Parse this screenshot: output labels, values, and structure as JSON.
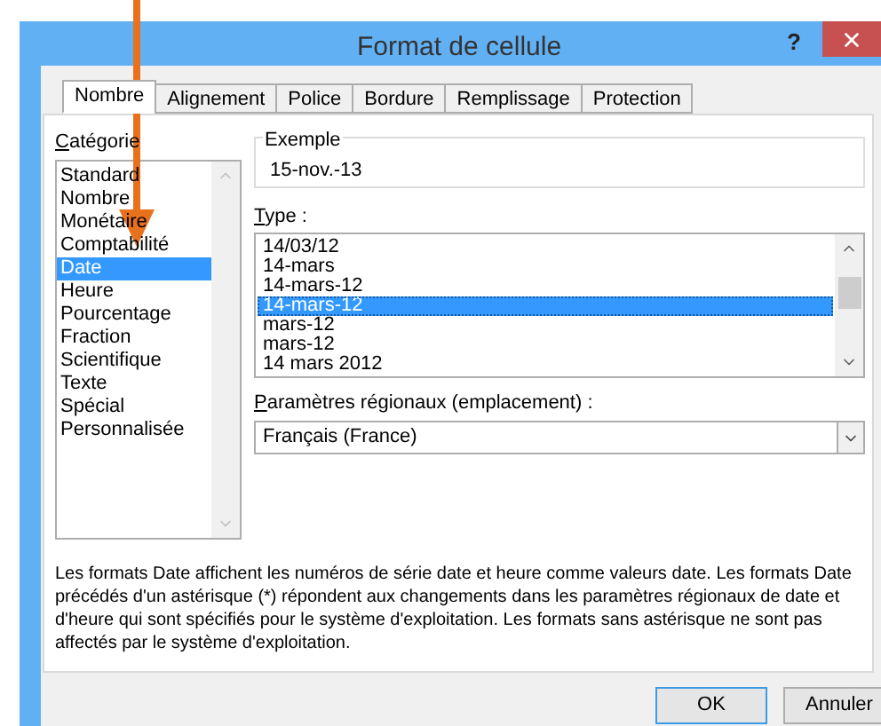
{
  "window": {
    "title": "Format de cellule",
    "help": "?"
  },
  "tabs": [
    {
      "label": "Nombre",
      "selected": true
    },
    {
      "label": "Alignement",
      "selected": false
    },
    {
      "label": "Police",
      "selected": false
    },
    {
      "label": "Bordure",
      "selected": false
    },
    {
      "label": "Remplissage",
      "selected": false
    },
    {
      "label": "Protection",
      "selected": false
    }
  ],
  "category": {
    "label": "Catégorie",
    "items": [
      {
        "label": "Standard",
        "selected": false
      },
      {
        "label": "Nombre",
        "selected": false
      },
      {
        "label": "Monétaire",
        "selected": false
      },
      {
        "label": "Comptabilité",
        "selected": false
      },
      {
        "label": "Date",
        "selected": true
      },
      {
        "label": "Heure",
        "selected": false
      },
      {
        "label": "Pourcentage",
        "selected": false
      },
      {
        "label": "Fraction",
        "selected": false
      },
      {
        "label": "Scientifique",
        "selected": false
      },
      {
        "label": "Texte",
        "selected": false
      },
      {
        "label": "Spécial",
        "selected": false
      },
      {
        "label": "Personnalisée",
        "selected": false
      }
    ]
  },
  "sample": {
    "label": "Exemple",
    "value": "15-nov.-13"
  },
  "type": {
    "label": "Type :",
    "items": [
      {
        "label": "14/03/12",
        "selected": false
      },
      {
        "label": "14-mars",
        "selected": false
      },
      {
        "label": "14-mars-12",
        "selected": false
      },
      {
        "label": "14-mars-12",
        "selected": true
      },
      {
        "label": "mars-12",
        "selected": false
      },
      {
        "label": "mars-12",
        "selected": false
      },
      {
        "label": "14 mars 2012",
        "selected": false
      }
    ]
  },
  "locale": {
    "label": "Paramètres régionaux (emplacement) :",
    "value": "Français (France)"
  },
  "description": "Les formats Date affichent les numéros de série date et heure comme valeurs date. Les formats Date précédés d'un astérisque (*) répondent aux changements dans les paramètres régionaux de date et d'heure qui sont spécifiés pour le système d'exploitation. Les formats sans astérisque ne sont pas affectés par le système d'exploitation.",
  "buttons": [
    {
      "label": "OK",
      "kind": "default"
    },
    {
      "label": "Annuler",
      "kind": "normal"
    }
  ]
}
